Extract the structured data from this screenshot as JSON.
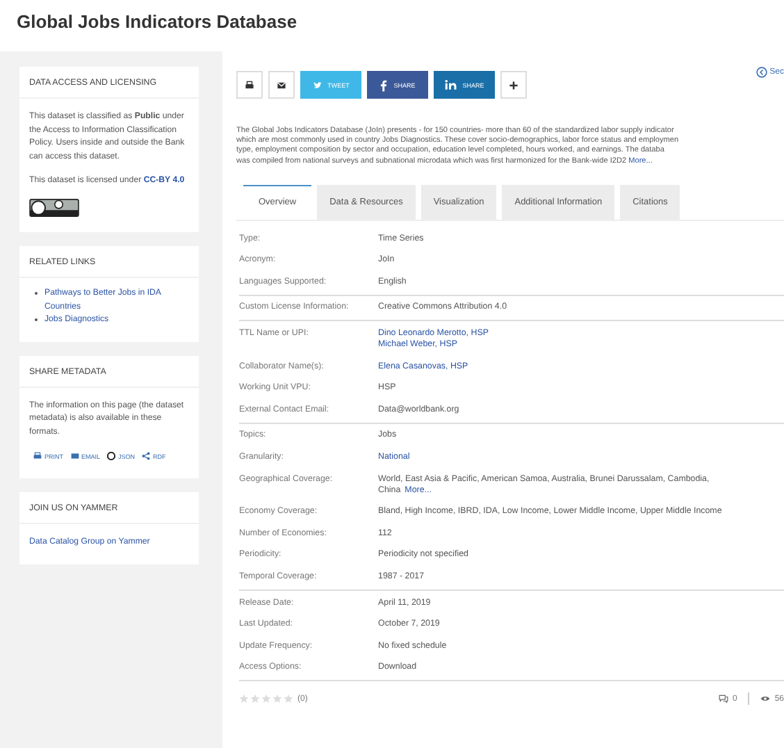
{
  "page_title": "Global Jobs Indicators Database",
  "sidebar": [
    {
      "kind": "access",
      "heading": "DATA ACCESS AND LICENSING",
      "text": "This dataset is classified as **Public** under the Access to Information Classification Policy. Users inside and outside the Bank can access this dataset.",
      "license_text": "This dataset is licensed under",
      "license_link": "CC-BY 4.0"
    },
    {
      "kind": "links",
      "heading": "RELATED LINKS",
      "links": [
        "Pathways to Better Jobs in IDA Countries",
        "Jobs Diagnostics"
      ]
    },
    {
      "kind": "share",
      "heading": "SHARE METADATA",
      "text": "The information on this page (the dataset metadata) is also available in these formats.",
      "formats": [
        {
          "kind": "print",
          "label": "PRINT"
        },
        {
          "kind": "email",
          "label": "EMAIL"
        },
        {
          "kind": "json",
          "label": "JSON"
        },
        {
          "kind": "rdf",
          "label": "RDF"
        }
      ]
    },
    {
      "kind": "yammer",
      "heading": "JOIN US ON YAMMER",
      "link": "Data Catalog Group on Yammer"
    }
  ],
  "share_buttons": [
    {
      "kind": "print"
    },
    {
      "kind": "email"
    },
    {
      "kind": "twitter",
      "label": "TWEET"
    },
    {
      "kind": "facebook",
      "label": "SHARE"
    },
    {
      "kind": "linkedin",
      "label": "SHARE"
    },
    {
      "kind": "plus"
    }
  ],
  "top_link": "Sec",
  "description": {
    "lines": [
      "The Global Jobs Indicators Database (JoIn) presents - for 150 countries- more than 60 of the standardized labor supply indicator",
      "which are most commonly used in country Jobs Diagnostics. These cover socio-demographics, labor force status and employmen",
      "type, employment composition by sector and occupation, education level completed, hours worked, and earnings. The databa",
      "was compiled from national surveys and subnational microdata which was first harmonized for the Bank-wide I2D2"
    ],
    "more": "More..."
  },
  "tabs": [
    {
      "label": "Overview",
      "selected": true
    },
    {
      "label": "Data & Resources",
      "selected": false
    },
    {
      "label": "Visualization",
      "selected": false
    },
    {
      "label": "Additional Information",
      "selected": false
    },
    {
      "label": "Citations",
      "selected": false
    }
  ],
  "metadata_groups": [
    [
      {
        "label": "Type:",
        "lines": [
          {
            "text": "Time Series",
            "link": false
          }
        ]
      },
      {
        "label": "Acronym:",
        "lines": [
          {
            "text": "JoIn",
            "link": false
          }
        ]
      },
      {
        "label": "Languages Supported:",
        "lines": [
          {
            "text": "English",
            "link": false
          }
        ]
      }
    ],
    [
      {
        "label": "Custom License Information:",
        "lines": [
          {
            "text": "Creative Commons Attribution 4.0",
            "link": false
          }
        ]
      }
    ],
    [
      {
        "label": "TTL Name or UPI:",
        "lines": [
          {
            "text": "Dino Leonardo Merotto, HSP",
            "link": true
          },
          {
            "text": "Michael Weber, HSP",
            "link": true
          }
        ]
      },
      {
        "label": "Collaborator Name(s):",
        "lines": [
          {
            "text": "Elena Casanovas, HSP",
            "link": true
          }
        ]
      },
      {
        "label": "Working Unit VPU:",
        "lines": [
          {
            "text": "HSP",
            "link": false
          }
        ]
      },
      {
        "label": "External Contact Email:",
        "lines": [
          {
            "text": "Data@worldbank.org",
            "link": false
          }
        ]
      }
    ],
    [
      {
        "label": "Topics:",
        "lines": [
          {
            "text": "Jobs",
            "link": false
          }
        ]
      },
      {
        "label": "Granularity:",
        "lines": [
          {
            "text": "National",
            "link": true
          }
        ]
      },
      {
        "label": "Geographical Coverage:",
        "lines": [
          {
            "text": "World, East Asia & Pacific, American Samoa, Australia, Brunei Darussalam, Cambodia,",
            "link": false
          },
          {
            "text": "China",
            "link": false,
            "more": "More..."
          }
        ]
      },
      {
        "label": "Economy Coverage:",
        "lines": [
          {
            "text": "Bland, High Income, IBRD, IDA, Low Income, Lower Middle Income, Upper Middle Income",
            "link": false
          }
        ]
      },
      {
        "label": "Number of Economies:",
        "lines": [
          {
            "text": "112",
            "link": false
          }
        ]
      },
      {
        "label": "Periodicity:",
        "lines": [
          {
            "text": "Periodicity not specified",
            "link": false
          }
        ]
      },
      {
        "label": "Temporal Coverage:",
        "lines": [
          {
            "text": "1987 - 2017",
            "link": false
          }
        ]
      }
    ],
    [
      {
        "label": "Release Date:",
        "lines": [
          {
            "text": "April 11, 2019",
            "link": false
          }
        ]
      },
      {
        "label": "Last Updated:",
        "lines": [
          {
            "text": "October 7, 2019",
            "link": false
          }
        ]
      },
      {
        "label": "Update Frequency:",
        "lines": [
          {
            "text": "No fixed schedule",
            "link": false
          }
        ]
      },
      {
        "label": "Access Options:",
        "lines": [
          {
            "text": "Download",
            "link": false
          }
        ]
      }
    ]
  ],
  "rating": {
    "stars": 0,
    "count": "(0)"
  },
  "comments": "0",
  "views": "56"
}
